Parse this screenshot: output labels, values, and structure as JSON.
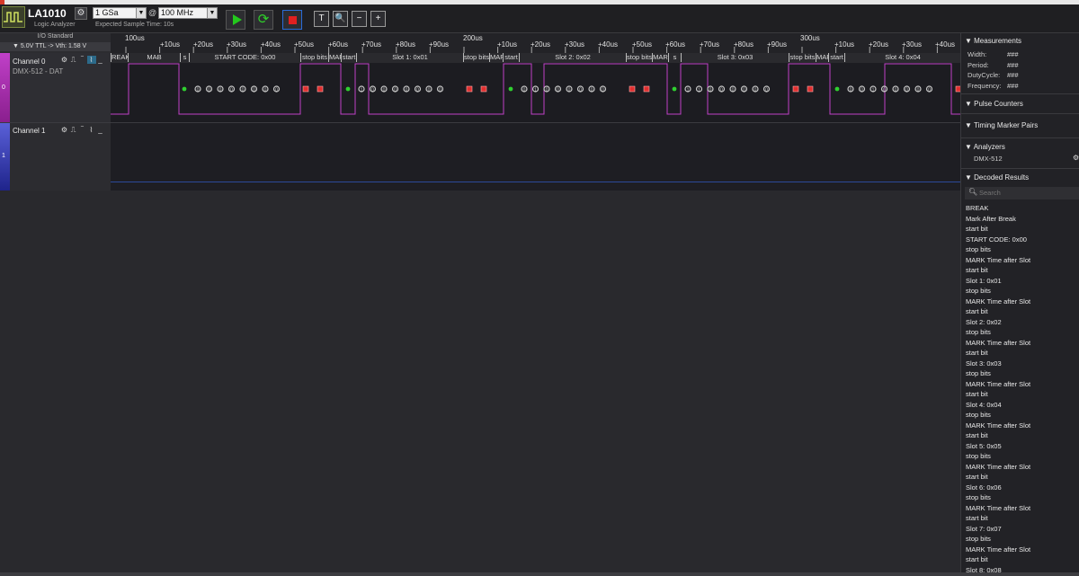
{
  "device": {
    "name": "LA1010",
    "subtitle": "Logic Analyzer",
    "sample_rate": "1 GSa",
    "at": "@",
    "frequency": "100 MHz",
    "sample_time": "Expected Sample Time: 10s"
  },
  "toolbar": {
    "text_glyph": "T",
    "zoom_sel_glyph": "🔍",
    "zoom_out_glyph": "−",
    "zoom_in_glyph": "+"
  },
  "io": {
    "standard": "I/O Standard",
    "threshold": "▼ 5.0V TTL -> Vth: 1.58 V"
  },
  "channels": [
    {
      "name": "Channel 0",
      "sub": "DMX-512 - DAT",
      "num": "0",
      "color": "#c040c8"
    },
    {
      "name": "Channel 1",
      "sub": "",
      "num": "1",
      "color": "#3a40c8"
    }
  ],
  "ruler": {
    "ticks": [
      "100us",
      "+10us",
      "+20us",
      "+30us",
      "+40us",
      "+50us",
      "+60us",
      "+70us",
      "+80us",
      "+90us",
      "200us",
      "+10us",
      "+20us",
      "+30us",
      "+40us",
      "+50us",
      "+60us",
      "+70us",
      "+80us",
      "+90us",
      "300us",
      "+10us",
      "+20us",
      "+30us",
      "+40us"
    ]
  },
  "decode_labels": [
    "REAK",
    "MAB",
    "s",
    "START CODE: 0x00",
    "stop bits",
    "MAR",
    "start",
    "Slot 1: 0x01",
    "stop bits",
    "MAR",
    "start",
    "Slot 2: 0x02",
    "stop bits",
    "MAR",
    "s",
    "Slot 3: 0x03",
    "stop bits",
    "MAR",
    "start",
    "Slot 4: 0x04"
  ],
  "frames": [
    {
      "bits": [
        "0",
        "0",
        "0",
        "0",
        "0",
        "0",
        "0",
        "0"
      ]
    },
    {
      "bits": [
        "1",
        "0",
        "0",
        "0",
        "0",
        "0",
        "0",
        "0"
      ]
    },
    {
      "bits": [
        "0",
        "1",
        "0",
        "0",
        "0",
        "0",
        "0",
        "0"
      ]
    },
    {
      "bits": [
        "1",
        "1",
        "0",
        "0",
        "0",
        "0",
        "0",
        "0"
      ]
    },
    {
      "bits": [
        "0",
        "0",
        "1",
        "0",
        "0",
        "0",
        "0",
        "0"
      ]
    }
  ],
  "right": {
    "measurements": "▼ Measurements",
    "rows": [
      {
        "label": "Width:",
        "value": "###"
      },
      {
        "label": "Period:",
        "value": "###"
      },
      {
        "label": "DutyCycle:",
        "value": "###"
      },
      {
        "label": "Frequency:",
        "value": "###"
      }
    ],
    "pulse_counters": "▼ Pulse Counters",
    "timing_markers": "▼ Timing Marker Pairs",
    "analyzers": "▼ Analyzers",
    "analyzer_name": "DMX-512",
    "decoded": "▼ Decoded Results",
    "search_placeholder": "Search",
    "results": [
      "BREAK",
      "Mark After Break",
      "start bit",
      "START CODE: 0x00",
      "stop bits",
      "MARK Time after Slot",
      "start bit",
      "Slot 1: 0x01",
      "stop bits",
      "MARK Time after Slot",
      "start bit",
      "Slot 2: 0x02",
      "stop bits",
      "MARK Time after Slot",
      "start bit",
      "Slot 3: 0x03",
      "stop bits",
      "MARK Time after Slot",
      "start bit",
      "Slot 4: 0x04",
      "stop bits",
      "MARK Time after Slot",
      "start bit",
      "Slot 5: 0x05",
      "stop bits",
      "MARK Time after Slot",
      "start bit",
      "Slot 6: 0x06",
      "stop bits",
      "MARK Time after Slot",
      "start bit",
      "Slot 7: 0x07",
      "stop bits",
      "MARK Time after Slot",
      "start bit",
      "Slot 8: 0x08"
    ]
  },
  "colors": {
    "wave": "#c040c8",
    "start_bit": "#30d030",
    "stop_bit": "#e03030",
    "data_bit": "#c8c8c8",
    "ch1_line": "#2c4a9a"
  }
}
